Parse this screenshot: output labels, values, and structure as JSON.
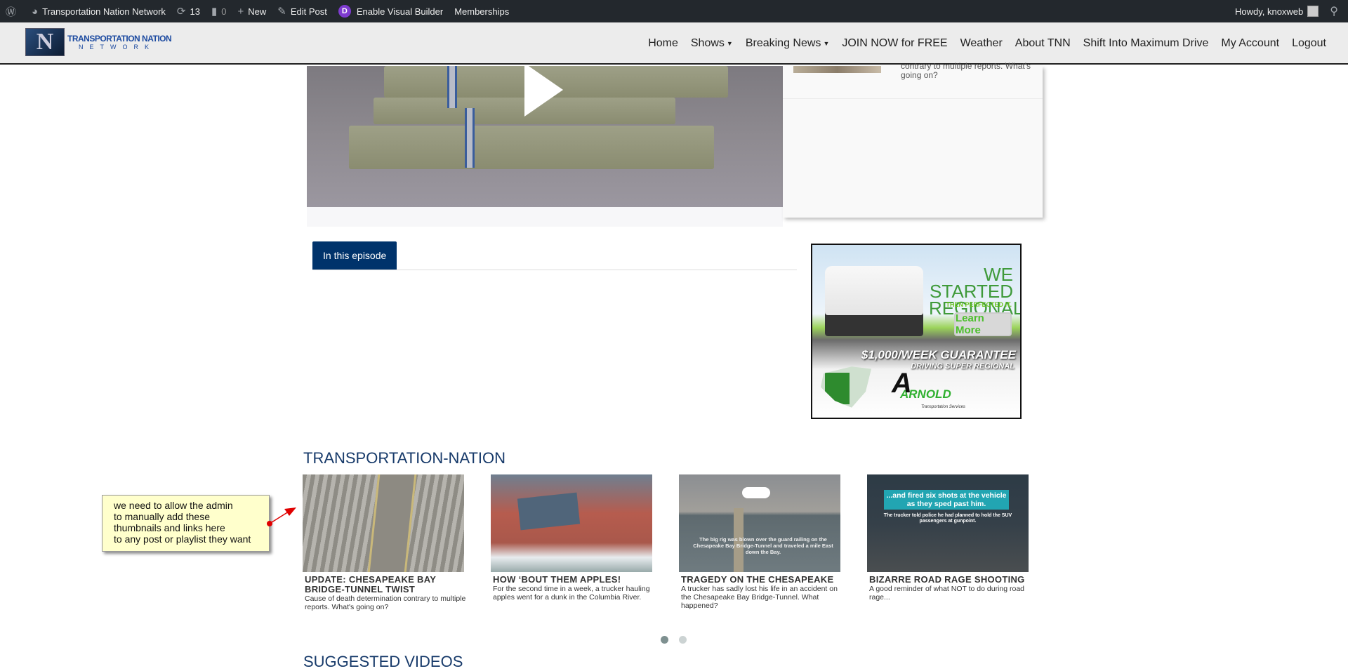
{
  "adminbar": {
    "site": "Transportation Nation Network",
    "updates": "13",
    "comments": "0",
    "new": "New",
    "edit": "Edit Post",
    "builder": "Enable Visual Builder",
    "builder_badge": "D",
    "memberships": "Memberships",
    "howdy": "Howdy, knoxweb"
  },
  "header": {
    "logo_line1": "TRANSPORTATION NATION",
    "logo_line2": "NETWORK",
    "nav": [
      "Home",
      "Shows",
      "Breaking News",
      "JOIN NOW for FREE",
      "Weather",
      "About TNN",
      "Shift Into Maximum Drive",
      "My Account",
      "Logout"
    ]
  },
  "sidebar": {
    "snippet": "contrary to multiple reports. What's going on?"
  },
  "tabs": {
    "active": "In this episode"
  },
  "ad": {
    "headline": "WE STARTED REGIONAL",
    "tagline": "THEN PERFECTED IT.",
    "button": "Learn More",
    "guarantee": "$1,000/WEEK GUARANTEE",
    "driving": "DRIVING SUPER REGIONAL",
    "brand": "ARNOLD",
    "brand_sub": "Transportation Services"
  },
  "section": {
    "title": "TRANSPORTATION-NATION"
  },
  "cards": [
    {
      "title": "UPDATE: CHESAPEAKE BAY BRIDGE-TUNNEL TWIST",
      "desc": "Cause of death determination contrary to multiple reports. What's going on?"
    },
    {
      "title": "HOW ‘BOUT THEM APPLES!",
      "desc": "For the second time in a week, a trucker hauling apples went for a dunk in the Columbia River."
    },
    {
      "title": "TRAGEDY ON THE CHESAPEAKE",
      "desc": "A trucker has sadly lost his life in an accident on the Chesapeake Bay Bridge-Tunnel. What happened?",
      "img_caption": "The big rig was blown over the guard railing on the Chesapeake Bay Bridge-Tunnel and traveled a mile East down the Bay."
    },
    {
      "title": "BIZARRE ROAD RAGE SHOOTING",
      "desc": "A good reminder of what NOT to do during road rage...",
      "img_caption": "...and fired six shots at the vehicle as they sped past him.",
      "img_sub": "The trucker told police he had planned to hold the SUV passengers at gunpoint."
    }
  ],
  "carousel": {
    "pages": 2,
    "active": 1
  },
  "section2": {
    "title": "SUGGESTED VIDEOS"
  },
  "note": {
    "text": "we need to allow the admin\nto manually add these\nthumbnails and links here\nto any post or playlist they want"
  },
  "colors": {
    "adminbar": "#23282d",
    "brand_blue": "#00336b",
    "heading": "#173a6a",
    "note_bg": "#ffffcc",
    "arrow": "#e00000"
  }
}
